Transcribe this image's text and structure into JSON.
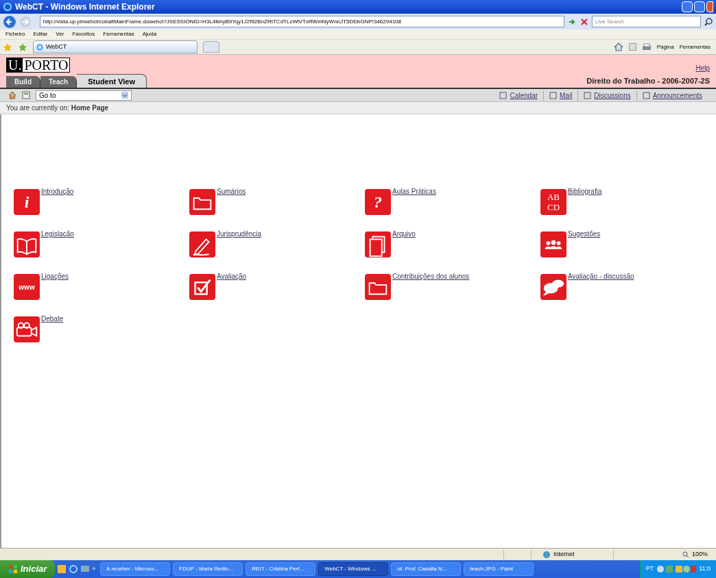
{
  "window": {
    "title": "WebCT - Windows Internet Explorer"
  },
  "address_bar": {
    "url": "http://vista.up.pt/webct/cobaltMainFrame.dowebct?JSESSIONID=H3L4lkhyB9Yqy1J2f92BnZRtTCdTLcWlVTxRWmNyWnnJT5DDbGNP!346294108",
    "search_placeholder": "Live Search"
  },
  "menu": [
    "Ficheiro",
    "Editar",
    "Ver",
    "Favoritos",
    "Ferramentas",
    "Ajuda"
  ],
  "browser_tab": {
    "title": "WebCT"
  },
  "command_bar": [
    "Página",
    "Ferramentas"
  ],
  "site": {
    "logo_left": "U.",
    "logo_right": "PORTO",
    "help": "Help",
    "course": "Direito do Trabalho - 2006-2007-2S",
    "tabs": [
      {
        "label": "Build",
        "selected": false
      },
      {
        "label": "Teach",
        "selected": false
      },
      {
        "label": "Student View",
        "selected": true
      }
    ],
    "goto": "Go to",
    "links": [
      "Calendar",
      "Mail",
      "Discussions",
      "Announcements"
    ],
    "breadcrumb_prefix": "You are currently on:",
    "breadcrumb_page": "Home Page"
  },
  "tools": [
    {
      "label": "Introdução",
      "kind": "glyph",
      "icon_text": "i"
    },
    {
      "label": "Sumários",
      "kind": "drawing"
    },
    {
      "label": "Aulas Práticas",
      "kind": "glyph",
      "icon_text": "?"
    },
    {
      "label": "Bibliografia",
      "kind": "letters",
      "icon_text": "ABCD"
    },
    {
      "label": "Legislação",
      "kind": "drawing"
    },
    {
      "label": "Jurisprudência",
      "kind": "drawing"
    },
    {
      "label": "Arquivo",
      "kind": "drawing"
    },
    {
      "label": "Sugestões",
      "kind": "drawing"
    },
    {
      "label": "Ligações",
      "kind": "glyph",
      "icon_text": "www"
    },
    {
      "label": "Avaliação",
      "kind": "drawing"
    },
    {
      "label": "Contribuições dos alunos",
      "kind": "drawing"
    },
    {
      "label": "Avaliação - discussão",
      "kind": "drawing"
    },
    {
      "label": "Debate",
      "kind": "drawing"
    }
  ],
  "status_bar": {
    "zone": "Internet",
    "zoom": "100%"
  },
  "taskbar": {
    "start": "Iniciar",
    "chevron": "»",
    "tasks": [
      {
        "label": "A receber - Microso...",
        "selected": false
      },
      {
        "label": "FDUP - Maria Redin...",
        "selected": false
      },
      {
        "label": "REIT - Cristina Perf...",
        "selected": false
      },
      {
        "label": "WebCT - Windows ...",
        "selected": true
      },
      {
        "label": "of. Prof. Casalta N...",
        "selected": false
      },
      {
        "label": "teach.JPG - Paint",
        "selected": false
      }
    ],
    "language": "PT",
    "clock": "11:0"
  }
}
